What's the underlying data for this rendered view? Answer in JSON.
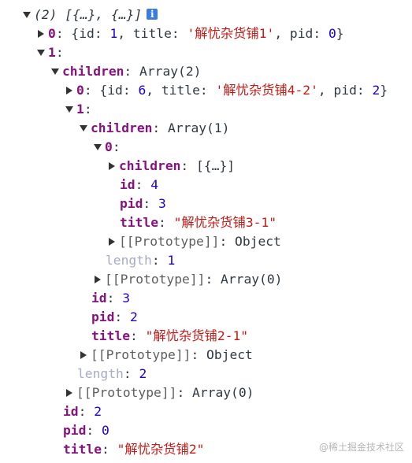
{
  "root": {
    "summary": "(2) [{…}, {…}]",
    "info_icon": "i"
  },
  "item0": {
    "key": "0",
    "preview_open": "{id: ",
    "id": "1",
    "sep1": ", title: ",
    "title": "'解忧杂货铺1'",
    "sep2": ", pid: ",
    "pid": "0",
    "preview_close": "}"
  },
  "item1": {
    "key": "1"
  },
  "children_l1": {
    "key": "children",
    "value": "Array(2)"
  },
  "c1_0": {
    "key": "0",
    "preview_open": "{id: ",
    "id": "6",
    "sep1": ", title: ",
    "title": "'解忧杂货铺4-2'",
    "sep2": ", pid: ",
    "pid": "2",
    "preview_close": "}"
  },
  "c1_1": {
    "key": "1"
  },
  "children_l2": {
    "key": "children",
    "value": "Array(1)"
  },
  "c2_0": {
    "key": "0"
  },
  "children_l3": {
    "key": "children",
    "value": "[{…}]"
  },
  "deep": {
    "id_key": "id",
    "id_val": "4",
    "pid_key": "pid",
    "pid_val": "3",
    "title_key": "title",
    "title_val": "\"解忧杂货铺3-1\"",
    "proto_key": "[[Prototype]]",
    "proto_val": "Object"
  },
  "l2_length": {
    "key": "length",
    "val": "1"
  },
  "l2_proto": {
    "key": "[[Prototype]]",
    "val": "Array(0)"
  },
  "mid": {
    "id_key": "id",
    "id_val": "3",
    "pid_key": "pid",
    "pid_val": "2",
    "title_key": "title",
    "title_val": "\"解忧杂货铺2-1\"",
    "proto_key": "[[Prototype]]",
    "proto_val": "Object"
  },
  "l1_length": {
    "key": "length",
    "val": "2"
  },
  "l1_proto": {
    "key": "[[Prototype]]",
    "val": "Array(0)"
  },
  "top": {
    "id_key": "id",
    "id_val": "2",
    "pid_key": "pid",
    "pid_val": "0",
    "title_key": "title",
    "title_val": "\"解忧杂货铺2\""
  },
  "watermark": "@稀土掘金技术社区",
  "colors": {
    "key": "#881280",
    "number": "#1c00cf",
    "string": "#c41a16",
    "dim_key": "#a9a9c9",
    "info_icon": "#3b7ddd"
  }
}
